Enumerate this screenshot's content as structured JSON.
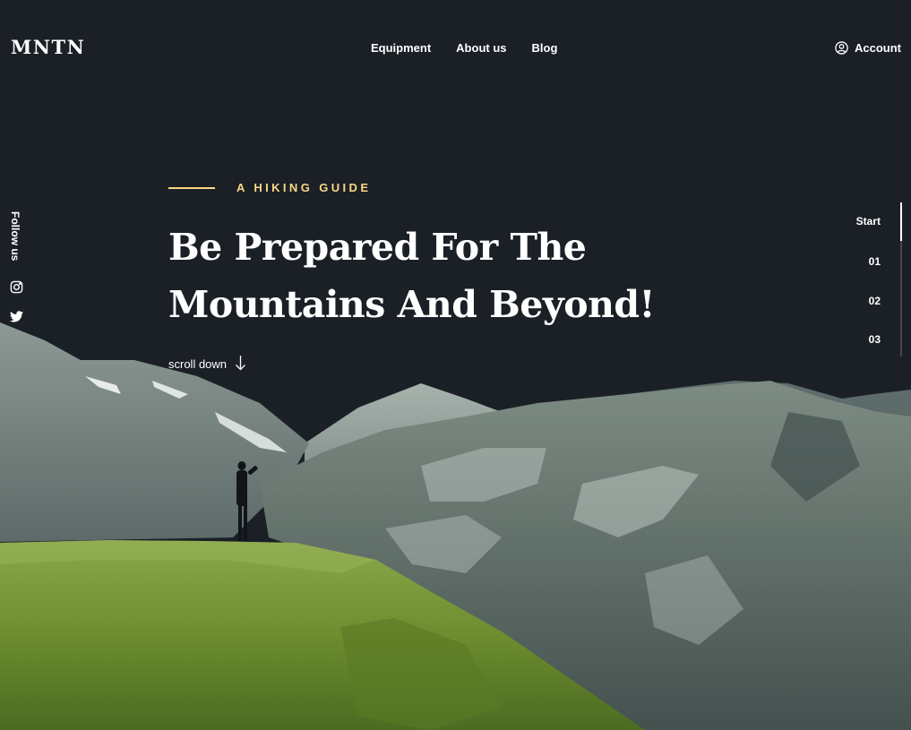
{
  "brand": {
    "logo": "MNTN"
  },
  "nav": {
    "items": [
      "Equipment",
      "About us",
      "Blog"
    ]
  },
  "account": {
    "label": "Account",
    "icon": "user-circle-icon"
  },
  "hero": {
    "eyebrow": "A HIKING GUIDE",
    "headline_line1": "Be Prepared For The",
    "headline_line2": "Mountains And Beyond!",
    "scroll_label": "scroll down"
  },
  "social": {
    "label": "Follow us",
    "icons": [
      "instagram-icon",
      "twitter-icon"
    ]
  },
  "steps": {
    "items": [
      "Start",
      "01",
      "02",
      "03"
    ],
    "active": "Start"
  },
  "colors": {
    "background": "#1b2027",
    "accent": "#fbd784",
    "text": "#ffffff"
  }
}
